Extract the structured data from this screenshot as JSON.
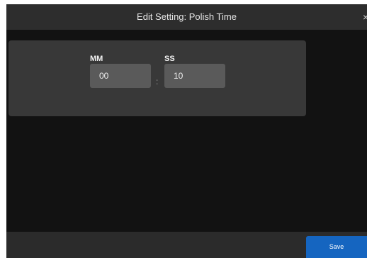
{
  "dialog": {
    "title": "Edit Setting: Polish Time",
    "close_icon": "×"
  },
  "time_fields": {
    "minutes": {
      "label": "MM",
      "value": "00"
    },
    "separator": ":",
    "seconds": {
      "label": "SS",
      "value": "10"
    }
  },
  "footer": {
    "save_label": "Save"
  },
  "colors": {
    "dialog_background": "#121212",
    "header_background": "#2d2d2d",
    "panel_background": "#383838",
    "field_background": "#5a5a5a",
    "footer_background": "#2b2b2b",
    "accent_save": "#1565c0"
  },
  "icons": {
    "close": "close-icon"
  }
}
